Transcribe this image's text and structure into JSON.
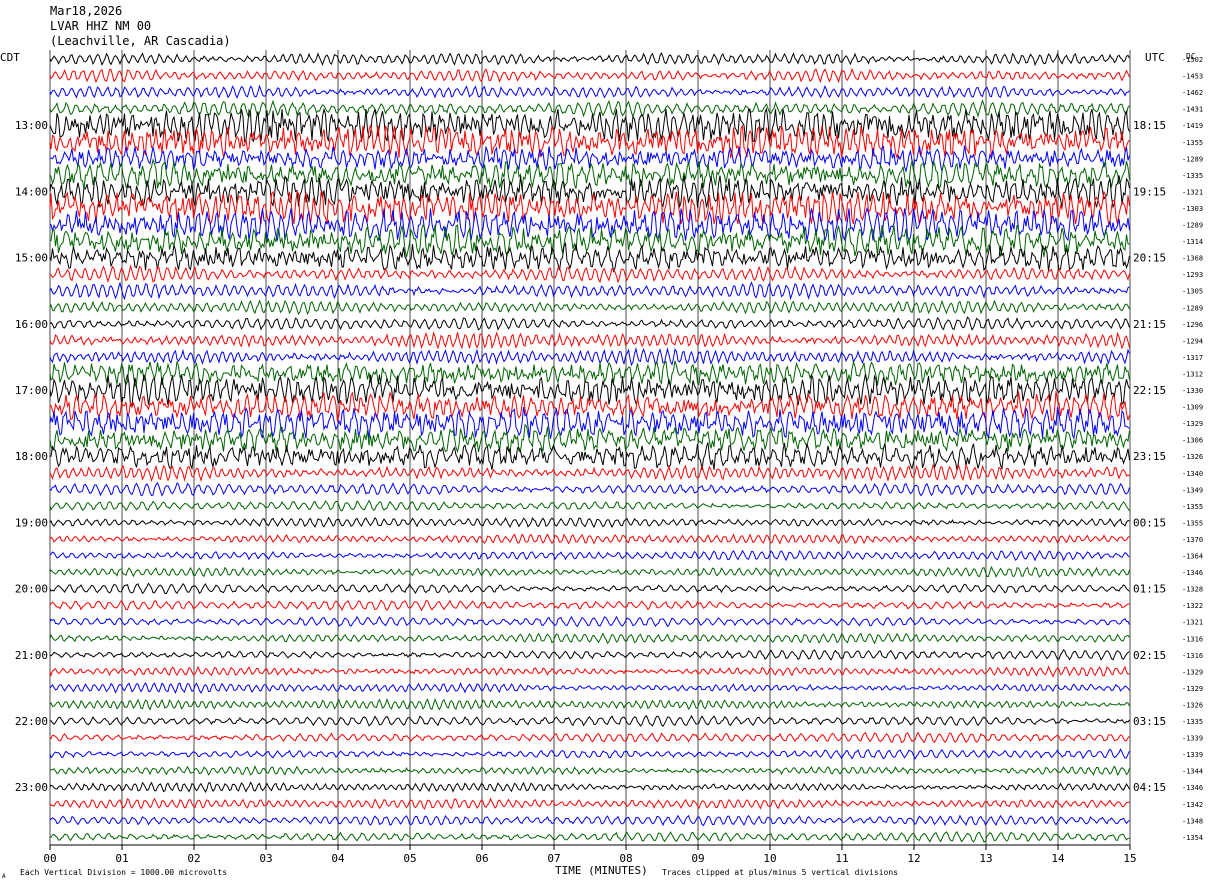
{
  "header": {
    "date": "Mar18,2026",
    "station": "LVAR HHZ NM 00",
    "location": "(Leachville, AR Cascadia)"
  },
  "axis": {
    "left_zone": "CDT",
    "right_zone": "UTC",
    "dc_label": "DC",
    "x_title": "TIME (MINUTES)",
    "scale_note": "Each Vertical Division = 1000.00 microvolts",
    "clip_note": "Traces clipped at plus/minus 5 vertical divisions",
    "corner_mark": "A"
  },
  "colors": {
    "trace_cycle": [
      "#000000",
      "#ff0000",
      "#0000ff",
      "#006400"
    ],
    "grid": "#000000"
  },
  "chart_data": {
    "type": "line",
    "title": "LVAR HHZ NM 00",
    "xlabel": "TIME (MINUTES)",
    "ylabel": "",
    "xlim": [
      0,
      15
    ],
    "x_ticks": [
      "00",
      "01",
      "02",
      "03",
      "04",
      "05",
      "06",
      "07",
      "08",
      "09",
      "10",
      "11",
      "12",
      "13",
      "14",
      "15"
    ],
    "left_ticks": [
      "13:00",
      "14:00",
      "15:00",
      "16:00",
      "17:00",
      "18:00",
      "19:00",
      "20:00",
      "21:00",
      "22:00",
      "23:00"
    ],
    "right_ticks": [
      "18:15",
      "19:15",
      "20:15",
      "21:15",
      "22:15",
      "23:15",
      "00:15",
      "01:15",
      "02:15",
      "03:15",
      "04:15"
    ],
    "trace_count": 48,
    "dc_offsets": [
      "-1502",
      "-1453",
      "-1462",
      "-1431",
      "-1419",
      "-1355",
      "-1289",
      "-1335",
      "-1321",
      "-1303",
      "-1289",
      "-1314",
      "-1368",
      "-1293",
      "-1305",
      "-1289",
      "-1296",
      "-1294",
      "-1317",
      "-1312",
      "-1330",
      "-1309",
      "-1329",
      "-1306",
      "-1326",
      "-1340",
      "-1349",
      "-1355",
      "-1355",
      "-1370",
      "-1364",
      "-1346",
      "-1328",
      "-1322",
      "-1321",
      "-1316",
      "-1316",
      "-1329",
      "-1329",
      "-1326",
      "-1335",
      "-1339",
      "-1339",
      "-1344",
      "-1346",
      "-1342",
      "-1348",
      "-1354"
    ],
    "activity_note_values": [
      3,
      3,
      3,
      4,
      9,
      8,
      5,
      6,
      7,
      9,
      8,
      7,
      6,
      4,
      4,
      3,
      3,
      4,
      4,
      5,
      7,
      6,
      7,
      6,
      6,
      4,
      3,
      2,
      2,
      2,
      2,
      2,
      2,
      2,
      2,
      2,
      2,
      2,
      2,
      2,
      2,
      2,
      2,
      2,
      2,
      2,
      2,
      2
    ]
  }
}
